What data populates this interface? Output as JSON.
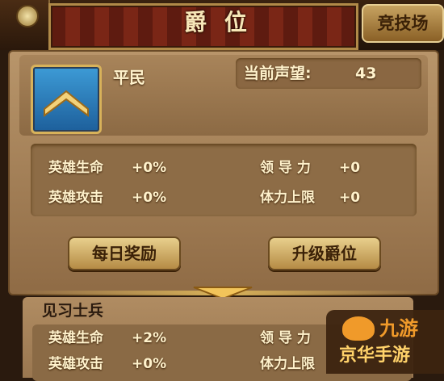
{
  "header": {
    "title": "爵 位",
    "arena_button": "竞技场"
  },
  "current_rank": {
    "name": "平民",
    "reputation_label": "当前声望:",
    "reputation_value": "43",
    "stats": [
      {
        "label": "英雄生命",
        "value": "+0%"
      },
      {
        "label": "英雄攻击",
        "value": "+0%"
      },
      {
        "label": "领 导 力",
        "value": "+0"
      },
      {
        "label": "体力上限",
        "value": "+0"
      }
    ]
  },
  "buttons": {
    "daily_reward": "每日奖励",
    "upgrade_rank": "升级爵位"
  },
  "next_rank": {
    "name": "见习士兵",
    "stats": [
      {
        "label": "英雄生命",
        "value": "+2%"
      },
      {
        "label": "英雄攻击",
        "value": "+0%"
      },
      {
        "label": "领 导 力",
        "value": ""
      },
      {
        "label": "体力上限",
        "value": ""
      }
    ]
  },
  "watermark": {
    "logo_text": "九游",
    "site_text": "京华手游"
  },
  "colors": {
    "banner_red": "#7a2616",
    "gold": "#d8b25a",
    "panel_brown": "#8d6c46",
    "icon_blue": "#3d9bd6"
  }
}
